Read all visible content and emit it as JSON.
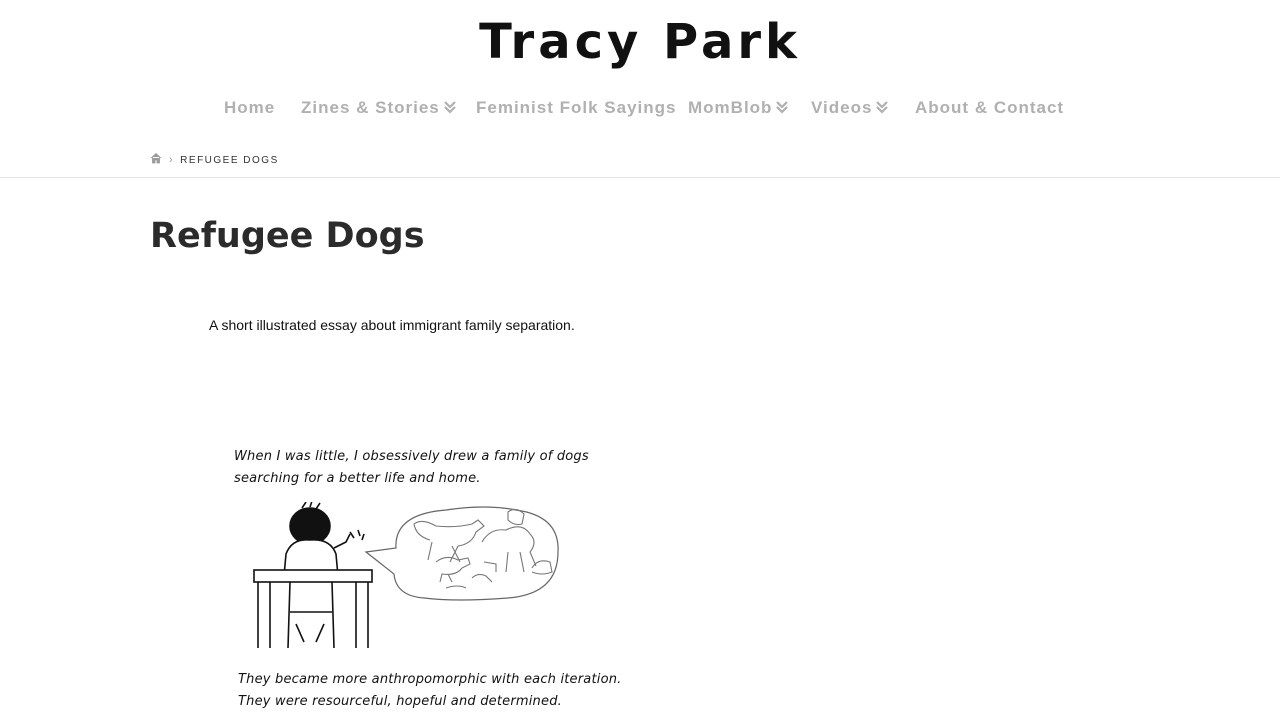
{
  "site": {
    "title": "Tracy Park"
  },
  "nav": {
    "items": [
      {
        "label": "Home",
        "has_dropdown": false
      },
      {
        "label": "Zines & Stories",
        "has_dropdown": true
      },
      {
        "label": "Feminist Folk Sayings",
        "has_dropdown": false
      },
      {
        "label": "MomBlob",
        "has_dropdown": true
      },
      {
        "label": "Videos",
        "has_dropdown": true
      },
      {
        "label": "About & Contact",
        "has_dropdown": false
      }
    ],
    "color": "#b0b0b0"
  },
  "breadcrumb": {
    "home_icon": "home-icon",
    "current": "REFUGEE DOGS"
  },
  "page": {
    "title": "Refugee Dogs",
    "intro": "A short illustrated essay about immigrant family separation."
  },
  "comic": {
    "caption_1a": "When I was little, I obsessively drew a family of dogs",
    "caption_1b": "searching for a better life and home.",
    "caption_2a": "They became more anthropomorphic with each iteration.",
    "caption_2b": "They were resourceful, hopeful and determined."
  }
}
